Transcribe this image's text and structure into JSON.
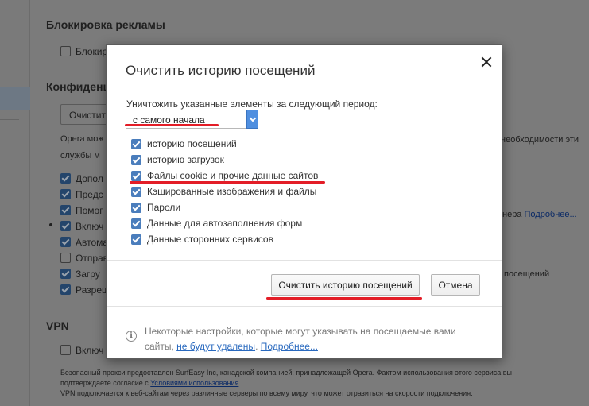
{
  "background": {
    "ad_block_title": "Блокировка рекламы",
    "ad_block_checkbox": "Блокир",
    "privacy_title": "Конфиденц",
    "clear_button": "Очистит",
    "opera_line1": "Opera мож",
    "opera_line2": "службы м",
    "opera_right": "необходимости эти",
    "options": [
      "Допол",
      "Предс",
      "Помог",
      "Включ",
      "Автома",
      "Отправ",
      "Загру",
      "Разреш",
      "Включ"
    ],
    "right_text_1": "нера",
    "right_link": "Подробнее...",
    "right_text_2": "посещений",
    "vpn_title": "VPN",
    "footer_line1": "Безопасный прокси предоставлен SurfEasy Inc, канадской компанией, принадлежащей Opera. Фактом использования этого сервиса вы",
    "footer_line2a": "подтверждаете согласие с ",
    "footer_link": "Условиями использования",
    "footer_line2b": ".",
    "footer_line3": "VPN подключается к веб-сайтам через различные серверы по всему миру, что может отразиться на скорости подключения."
  },
  "dialog": {
    "title": "Очистить историю посещений",
    "period_label": "Уничтожить указанные элементы за следующий период:",
    "period_value": "с самого начала",
    "items": [
      {
        "label": "историю посещений",
        "checked": true
      },
      {
        "label": "историю загрузок",
        "checked": true
      },
      {
        "label": "Файлы cookie и прочие данные сайтов",
        "checked": true
      },
      {
        "label": "Кэшированные изображения и файлы",
        "checked": true
      },
      {
        "label": "Пароли",
        "checked": true
      },
      {
        "label": "Данные для автозаполнения форм",
        "checked": true
      },
      {
        "label": "Данные сторонних сервисов",
        "checked": true
      }
    ],
    "clear_button": "Очистить историю посещений",
    "cancel_button": "Отмена",
    "info_icon": "i",
    "info_text_1": "Некоторые настройки, которые могут указывать на посещаемые вами сайты, ",
    "info_link_1": "не будут удалены",
    "info_text_2": ". ",
    "info_link_2": "Подробнее..."
  },
  "colors": {
    "accent": "#4a7dbc",
    "annotation_red": "#e31d27",
    "link": "#2a6abf"
  }
}
